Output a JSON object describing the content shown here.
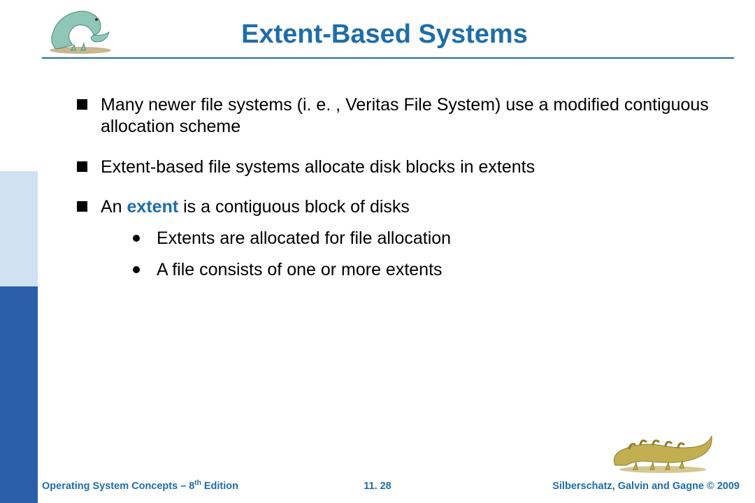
{
  "title": "Extent-Based Systems",
  "bullets": [
    {
      "text": "Many newer file systems (i. e. , Veritas File System) use a modified contiguous allocation scheme"
    },
    {
      "text": "Extent-based file systems allocate disk blocks in extents"
    },
    {
      "prefix": "An ",
      "keyword": "extent",
      "suffix": " is a contiguous block of disks",
      "sub": [
        "Extents are allocated for file allocation",
        "A file consists of one or more extents"
      ]
    }
  ],
  "footer": {
    "left_pre": "Operating System Concepts – 8",
    "left_sup": "th",
    "left_post": " Edition",
    "center": "11. 28",
    "right": "Silberschatz, Galvin and Gagne © 2009"
  },
  "icons": {
    "dino_top": "dinosaur-icon",
    "dino_bottom": "dinosaur-icon"
  }
}
